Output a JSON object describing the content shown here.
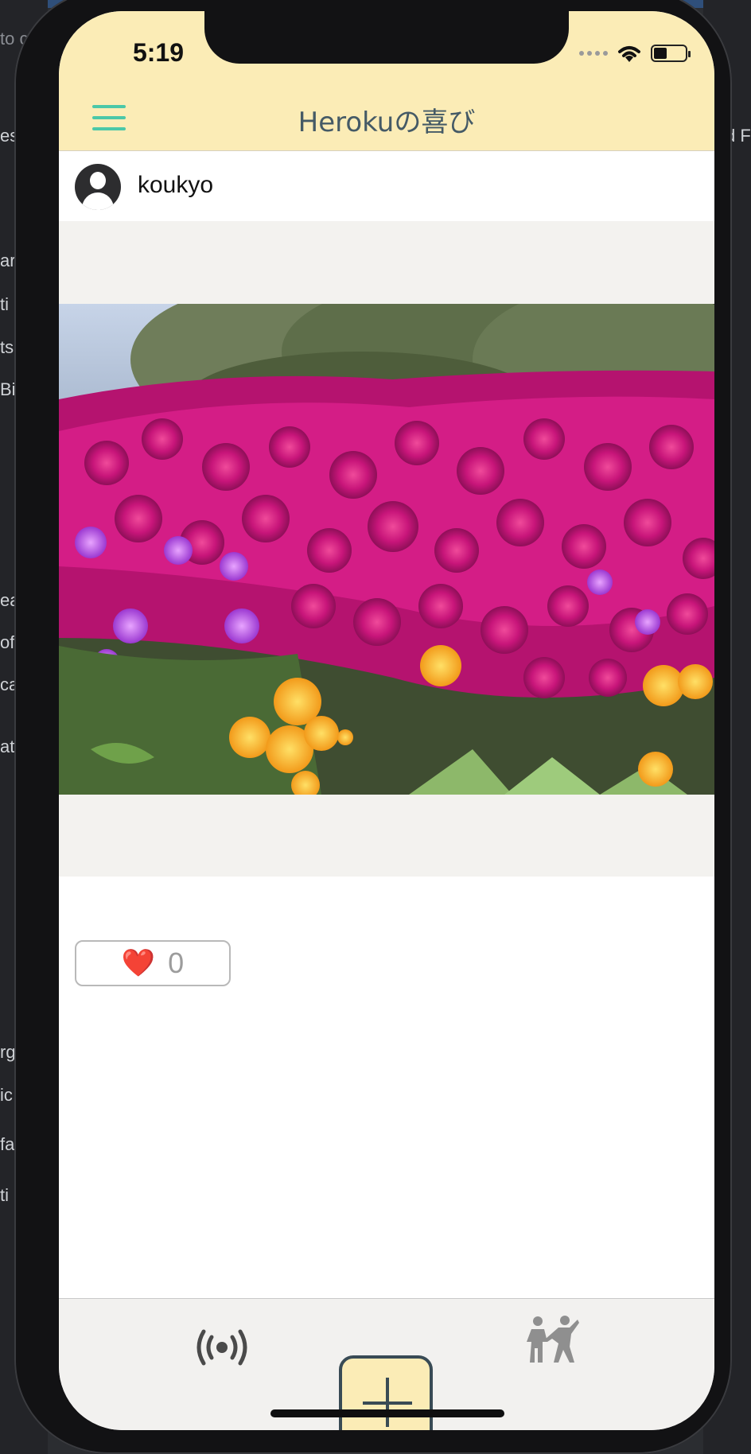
{
  "status_bar": {
    "time": "5:19",
    "icons": [
      "signal-dots-icon",
      "wifi-icon",
      "battery-icon"
    ]
  },
  "navbar": {
    "title": "Herokuの喜び",
    "menu_icon": "hamburger-menu-icon",
    "accent_color": "#4bc8a8",
    "background_color": "#fbecb6"
  },
  "post": {
    "username": "koukyo",
    "avatar_icon": "user-avatar-icon",
    "photo": "flower-field-photo",
    "likes": {
      "icon": "❤️",
      "count": "0"
    }
  },
  "tab_bar": {
    "items": [
      {
        "icon": "broadcast-icon"
      },
      {
        "icon": "add-post-icon"
      },
      {
        "icon": "people-dancing-icon"
      }
    ]
  },
  "background_app": {
    "left_text": [
      "to c",
      "es",
      "ar",
      "ti",
      "ts",
      "Bi",
      "ea",
      "of",
      "ca",
      "at",
      "rg",
      "ic",
      "fa",
      "ti"
    ],
    "right_text": [
      "d F"
    ]
  }
}
